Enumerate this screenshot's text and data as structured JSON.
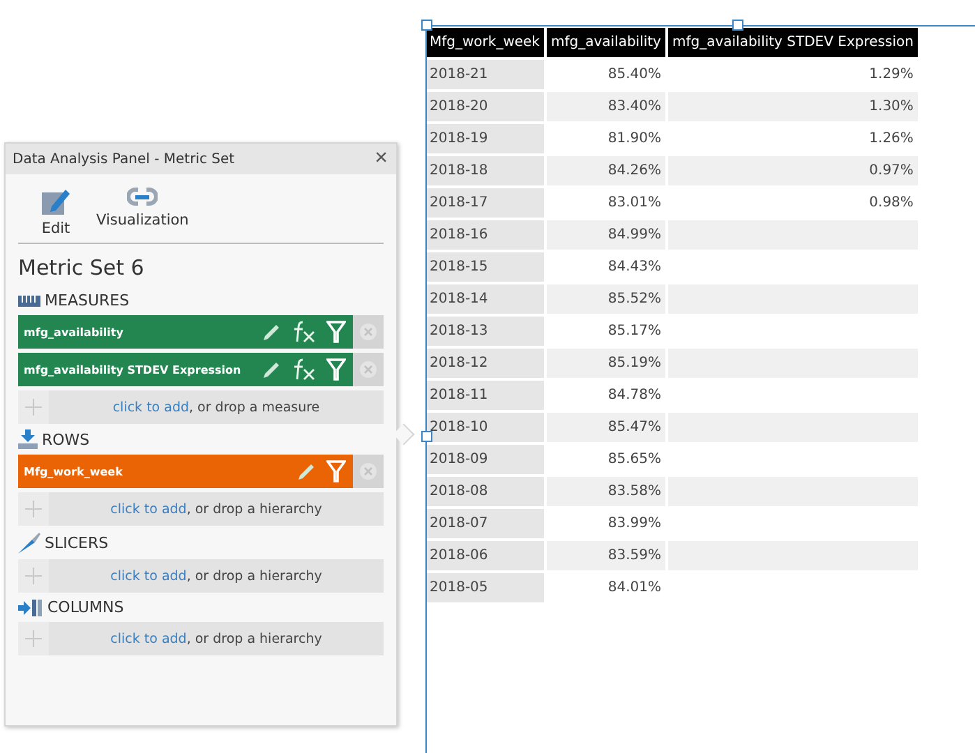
{
  "panel": {
    "title": "Data Analysis Panel - Metric Set",
    "close": "×",
    "toolbar": [
      {
        "label": "Edit",
        "kind": "edit"
      },
      {
        "label": "Visualization",
        "kind": "link"
      }
    ],
    "heading": "Metric Set 6",
    "sections": [
      {
        "title": "MEASURES",
        "kind": "measures",
        "items": [
          {
            "label": "mfg_availability",
            "kind": "measure"
          },
          {
            "label": "mfg_availability STDEV Expression",
            "kind": "measure"
          }
        ],
        "add_link": "click to add",
        "add_text": ", or drop a measure"
      },
      {
        "title": "ROWS",
        "kind": "rows",
        "items": [
          {
            "label": "Mfg_work_week",
            "kind": "hierarchy"
          }
        ],
        "add_link": "click to add",
        "add_text": ", or drop a hierarchy"
      },
      {
        "title": "SLICERS",
        "kind": "slicers",
        "add_link": "click to add",
        "add_text": ", or drop a hierarchy"
      },
      {
        "title": "COLUMNS",
        "kind": "columns",
        "add_link": "click to add",
        "add_text": ", or drop a hierarchy"
      }
    ]
  },
  "table": {
    "columns": [
      "Mfg_work_week",
      "mfg_availability",
      "mfg_availability STDEV Expression"
    ],
    "rows": [
      [
        "2018-21",
        "85.40%",
        "1.29%"
      ],
      [
        "2018-20",
        "83.40%",
        "1.30%"
      ],
      [
        "2018-19",
        "81.90%",
        "1.26%"
      ],
      [
        "2018-18",
        "84.26%",
        "0.97%"
      ],
      [
        "2018-17",
        "83.01%",
        "0.98%"
      ],
      [
        "2018-16",
        "84.99%",
        ""
      ],
      [
        "2018-15",
        "84.43%",
        ""
      ],
      [
        "2018-14",
        "85.52%",
        ""
      ],
      [
        "2018-13",
        "85.17%",
        ""
      ],
      [
        "2018-12",
        "85.19%",
        ""
      ],
      [
        "2018-11",
        "84.78%",
        ""
      ],
      [
        "2018-10",
        "85.47%",
        ""
      ],
      [
        "2018-09",
        "85.65%",
        ""
      ],
      [
        "2018-08",
        "83.58%",
        ""
      ],
      [
        "2018-07",
        "83.99%",
        ""
      ],
      [
        "2018-06",
        "83.59%",
        ""
      ],
      [
        "2018-05",
        "84.01%",
        ""
      ]
    ]
  }
}
